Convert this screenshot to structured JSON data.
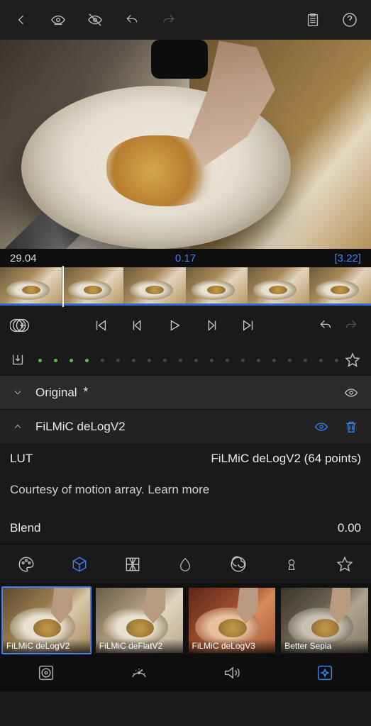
{
  "time": {
    "left": "29.04",
    "mid": "0.17",
    "right": "[3.22]"
  },
  "layers": {
    "original": {
      "label": "Original",
      "modified": "*"
    },
    "active": {
      "label": "FiLMiC deLogV2"
    }
  },
  "lut": {
    "label": "LUT",
    "value": "FiLMiC deLogV2 (64 points)",
    "courtesy": "Courtesy of motion array. Learn more"
  },
  "blend": {
    "label": "Blend",
    "value": "0.00"
  },
  "presets": [
    {
      "label": "FiLMiC deLogV2"
    },
    {
      "label": "FiLMiC deFlatV2"
    },
    {
      "label": "FiLMiC deLogV3"
    },
    {
      "label": "Better Sepia"
    }
  ]
}
